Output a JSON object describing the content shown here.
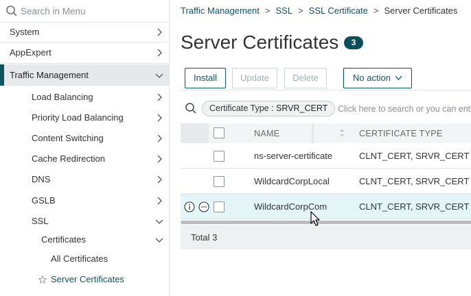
{
  "sidebar": {
    "search_placeholder": "Search in Menu",
    "items": [
      {
        "label": "System"
      },
      {
        "label": "AppExpert"
      },
      {
        "label": "Traffic Management"
      },
      {
        "label": "Load Balancing"
      },
      {
        "label": "Priority Load Balancing"
      },
      {
        "label": "Content Switching"
      },
      {
        "label": "Cache Redirection"
      },
      {
        "label": "DNS"
      },
      {
        "label": "GSLB"
      },
      {
        "label": "SSL"
      },
      {
        "label": "Certificates"
      },
      {
        "label": "All Certificates"
      },
      {
        "label": "Server Certificates"
      }
    ]
  },
  "breadcrumb": {
    "items": [
      "Traffic Management",
      "SSL",
      "SSL Certificate"
    ],
    "current": "Server Certificates"
  },
  "page": {
    "title": "Server Certificates",
    "count": "3"
  },
  "toolbar": {
    "install": "Install",
    "update": "Update",
    "delete": "Delete",
    "action": "No action"
  },
  "filter": {
    "chip_key": "Certificate Type : ",
    "chip_value": "SRVR_CERT",
    "hint": "Click here to search or you can enter Key : Value format"
  },
  "table": {
    "columns": [
      "NAME",
      "CERTIFICATE TYPE"
    ],
    "rows": [
      {
        "name": "ns-server-certificate",
        "type": "CLNT_CERT, SRVR_CERT"
      },
      {
        "name": "WildcardCorpLocal",
        "type": "CLNT_CERT, SRVR_CERT"
      },
      {
        "name": "WildcardCorpCom",
        "type": "CLNT_CERT, SRVR_CERT"
      }
    ],
    "footer": "Total 3"
  },
  "colors": {
    "accent": "#0b5560",
    "row_highlight": "#e3f5f7"
  }
}
